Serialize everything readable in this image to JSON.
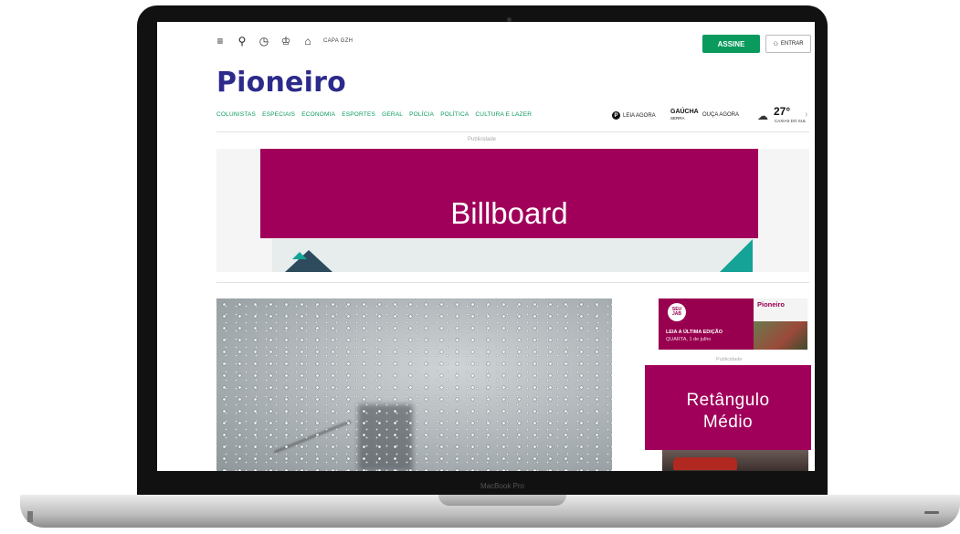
{
  "laptop": {
    "model_label": "MacBook Pro"
  },
  "header": {
    "menu_icon": "hamburger-icon",
    "capa_label": "CAPA GZH",
    "assine_label": "ASSINE",
    "entrar_label": "ENTRAR",
    "logo_text": "Pioneiro",
    "brand_color": "#2c2a8a",
    "accent_color": "#0a9a5e"
  },
  "nav": {
    "items": [
      {
        "label": "COLUNISTAS"
      },
      {
        "label": "ESPECIAIS"
      },
      {
        "label": "ECONOMIA"
      },
      {
        "label": "ESPORTES"
      },
      {
        "label": "GERAL"
      },
      {
        "label": "POLÍCIA"
      },
      {
        "label": "POLÍTICA"
      },
      {
        "label": "CULTURA E LAZER"
      }
    ],
    "leia_label": "LEIA AGORA",
    "gaucha_label": "GAÚCHA",
    "gaucha_sub": "SERRA",
    "ouca_label": "OUÇA AGORA"
  },
  "weather": {
    "temperature": "27°",
    "city": "CAXIAS DO SUL"
  },
  "ads": {
    "publicidade_label": "Publicidade",
    "billboard_label": "Billboard",
    "billboard_color": "#a0005a",
    "promo": {
      "badge_text": "SEU JAB",
      "line1": "LEIA A ÚLTIMA EDIÇÃO",
      "line2": "QUARTA, 1 de julho",
      "brand": "Pioneiro"
    },
    "publicidade_label_2": "Publicidade",
    "retangulo_line1": "Retângulo",
    "retangulo_line2": "Médio"
  }
}
